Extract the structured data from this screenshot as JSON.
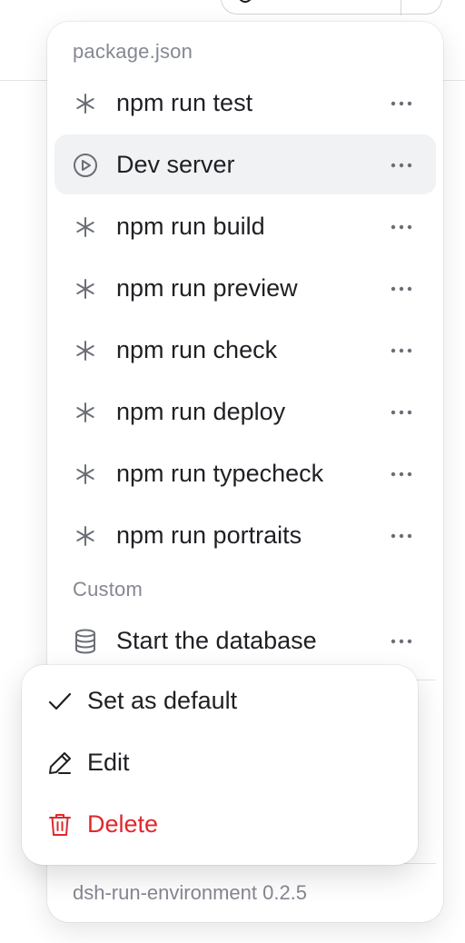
{
  "sections": [
    {
      "label": "package.json",
      "items": [
        {
          "label": "npm run test",
          "icon": "asterisk-icon",
          "active": false
        },
        {
          "label": "Dev server",
          "icon": "play-circle-icon",
          "active": true
        },
        {
          "label": "npm run build",
          "icon": "asterisk-icon",
          "active": false
        },
        {
          "label": "npm run preview",
          "icon": "asterisk-icon",
          "active": false
        },
        {
          "label": "npm run check",
          "icon": "asterisk-icon",
          "active": false
        },
        {
          "label": "npm run deploy",
          "icon": "asterisk-icon",
          "active": false
        },
        {
          "label": "npm run typecheck",
          "icon": "asterisk-icon",
          "active": false
        },
        {
          "label": "npm run portraits",
          "icon": "asterisk-icon",
          "active": false
        }
      ]
    },
    {
      "label": "Custom",
      "items": [
        {
          "label": "Start the database",
          "icon": "database-icon",
          "active": false
        }
      ]
    }
  ],
  "context_menu": {
    "items": [
      {
        "label": "Set as default",
        "icon": "check-icon"
      },
      {
        "label": "Edit",
        "icon": "pencil-icon"
      },
      {
        "label": "Delete",
        "icon": "trash-icon",
        "danger": true
      }
    ]
  },
  "footer": {
    "version_text": "dsh-run-environment 0.2.5"
  },
  "colors": {
    "danger": "#e0282c",
    "muted": "#858892",
    "active_row": "#f1f2f4"
  }
}
